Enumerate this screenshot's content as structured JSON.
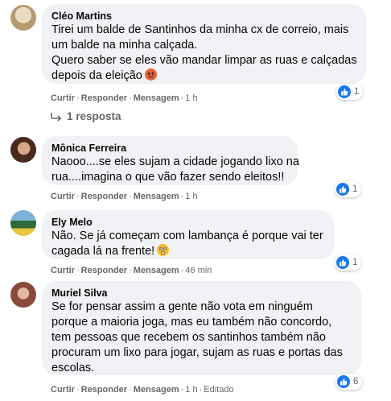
{
  "comments": [
    {
      "author": "Cléo Martins",
      "lines": [
        "Tirei um balde de Santinhos da minha cx de correio, mais",
        "um balde na minha calçada.",
        "Quero saber se eles vão mandar limpar as ruas e calçadas",
        "depois da eleição"
      ],
      "emoji": "angry-face-icon",
      "actions": {
        "like": "Curtir",
        "reply": "Responder",
        "message": "Mensagem",
        "time": "1 h"
      },
      "reactions": "1",
      "avatar_colors": [
        "#d9c8a8",
        "#b0916a"
      ]
    },
    {
      "author": "Mônica Ferreira",
      "lines": [
        "Naooo....se eles sujam a cidade jogando lixo na",
        "rua....imagina o que vão fazer sendo eleitos!!"
      ],
      "actions": {
        "like": "Curtir",
        "reply": "Responder",
        "message": "Mensagem",
        "time": "1 h"
      },
      "reactions": "1",
      "avatar_colors": [
        "#5a3a2a",
        "#c99a7a"
      ]
    },
    {
      "author": "Ely Melo",
      "lines": [
        "Não. Se já começam com lambança é porque vai ter",
        "cagada lá na frente!"
      ],
      "emoji": "flushed-face-icon",
      "actions": {
        "like": "Curtir",
        "reply": "Responder",
        "message": "Mensagem",
        "time": "46 min"
      },
      "reactions": "1",
      "avatar_colors": [
        "#2f6b3a",
        "#e8c440"
      ]
    },
    {
      "author": "Muriel Silva",
      "lines": [
        "Se for pensar assim a gente não vota em ninguém",
        "porque a maioria joga, mas eu também não concordo,",
        "tem pessoas que recebem os santinhos também não",
        "procuram um lixo para jogar, sujam as ruas e portas das",
        "escolas."
      ],
      "actions": {
        "like": "Curtir",
        "reply": "Responder",
        "message": "Mensagem",
        "time": "1 h",
        "edited": "Editado"
      },
      "reactions": "6",
      "avatar_colors": [
        "#8a4a3a",
        "#e4b8a0"
      ]
    }
  ],
  "replies_link": "1 resposta",
  "colors": {
    "bubble": "#f0f2f5",
    "like_blue": "#1877f2",
    "meta_gray": "#65676b"
  }
}
